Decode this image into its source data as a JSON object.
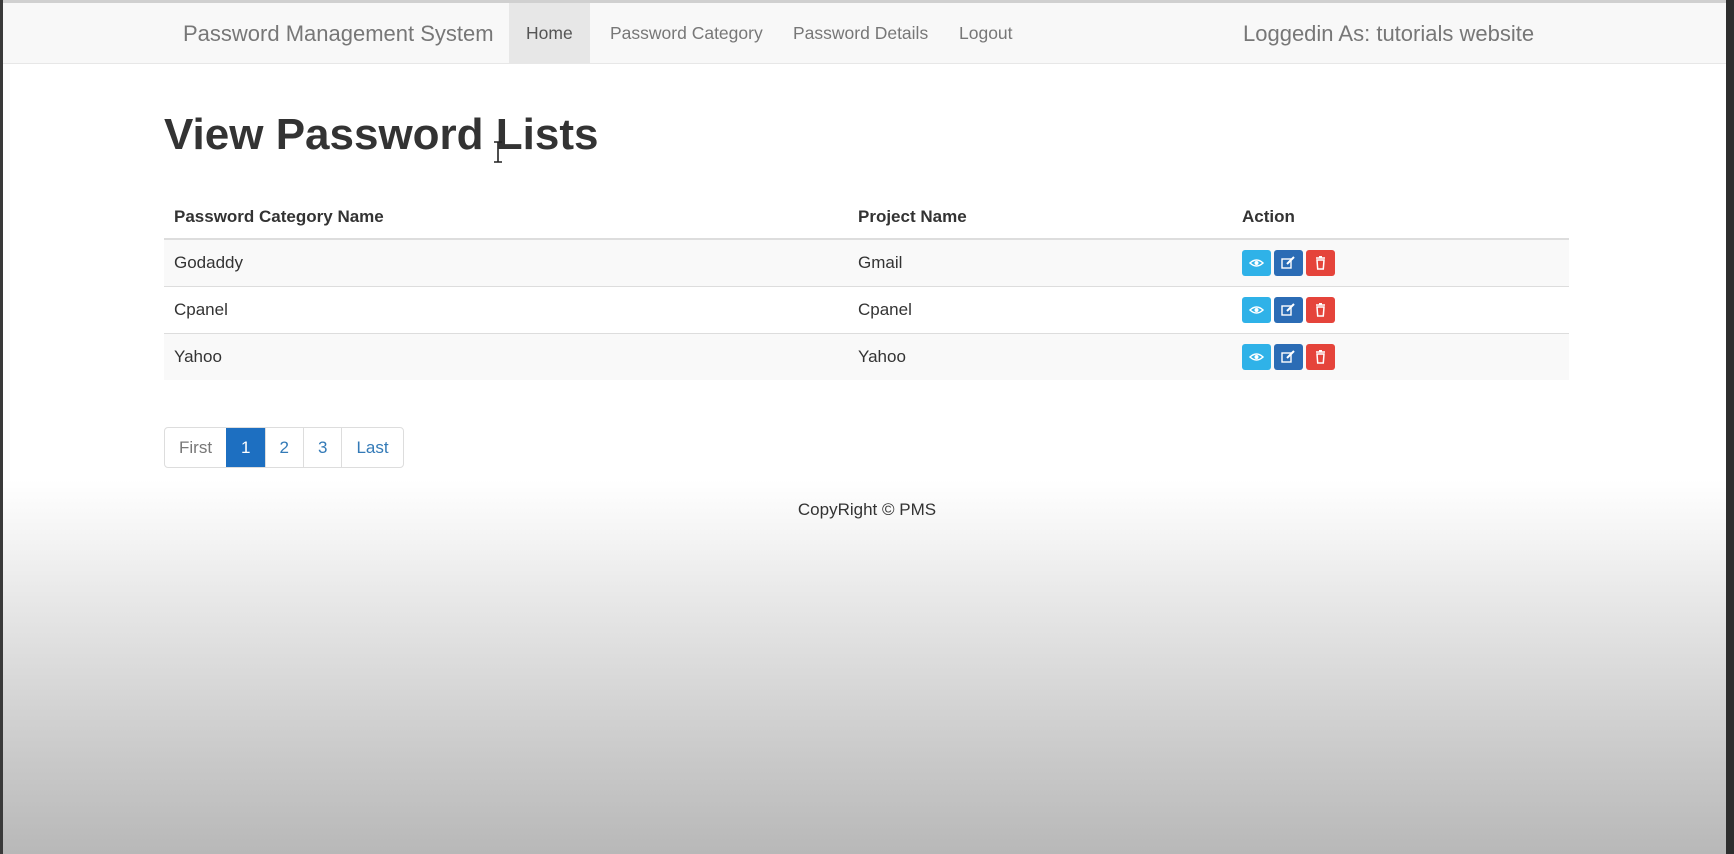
{
  "navbar": {
    "brand": "Password Management System",
    "items": [
      {
        "label": "Home",
        "active": true
      },
      {
        "label": "Password Category",
        "active": false
      },
      {
        "label": "Password Details",
        "active": false
      },
      {
        "label": "Logout",
        "active": false
      }
    ],
    "logged_in": "Loggedin As: tutorials website"
  },
  "page": {
    "title": "View Password Lists"
  },
  "table": {
    "headers": [
      "Password Category Name",
      "Project Name",
      "Action"
    ],
    "rows": [
      {
        "category": "Godaddy",
        "project": "Gmail"
      },
      {
        "category": "Cpanel",
        "project": "Cpanel"
      },
      {
        "category": "Yahoo",
        "project": "Yahoo"
      }
    ],
    "action_icons": [
      "eye-icon",
      "edit-icon",
      "trash-icon"
    ]
  },
  "pagination": {
    "first": "First",
    "pages": [
      "1",
      "2",
      "3"
    ],
    "current": "1",
    "last": "Last"
  },
  "footer": {
    "text": "CopyRight © PMS"
  },
  "colors": {
    "view": "#2fb2e8",
    "edit": "#2b6cb5",
    "delete": "#e5443b",
    "active_page": "#1d6fc1"
  }
}
